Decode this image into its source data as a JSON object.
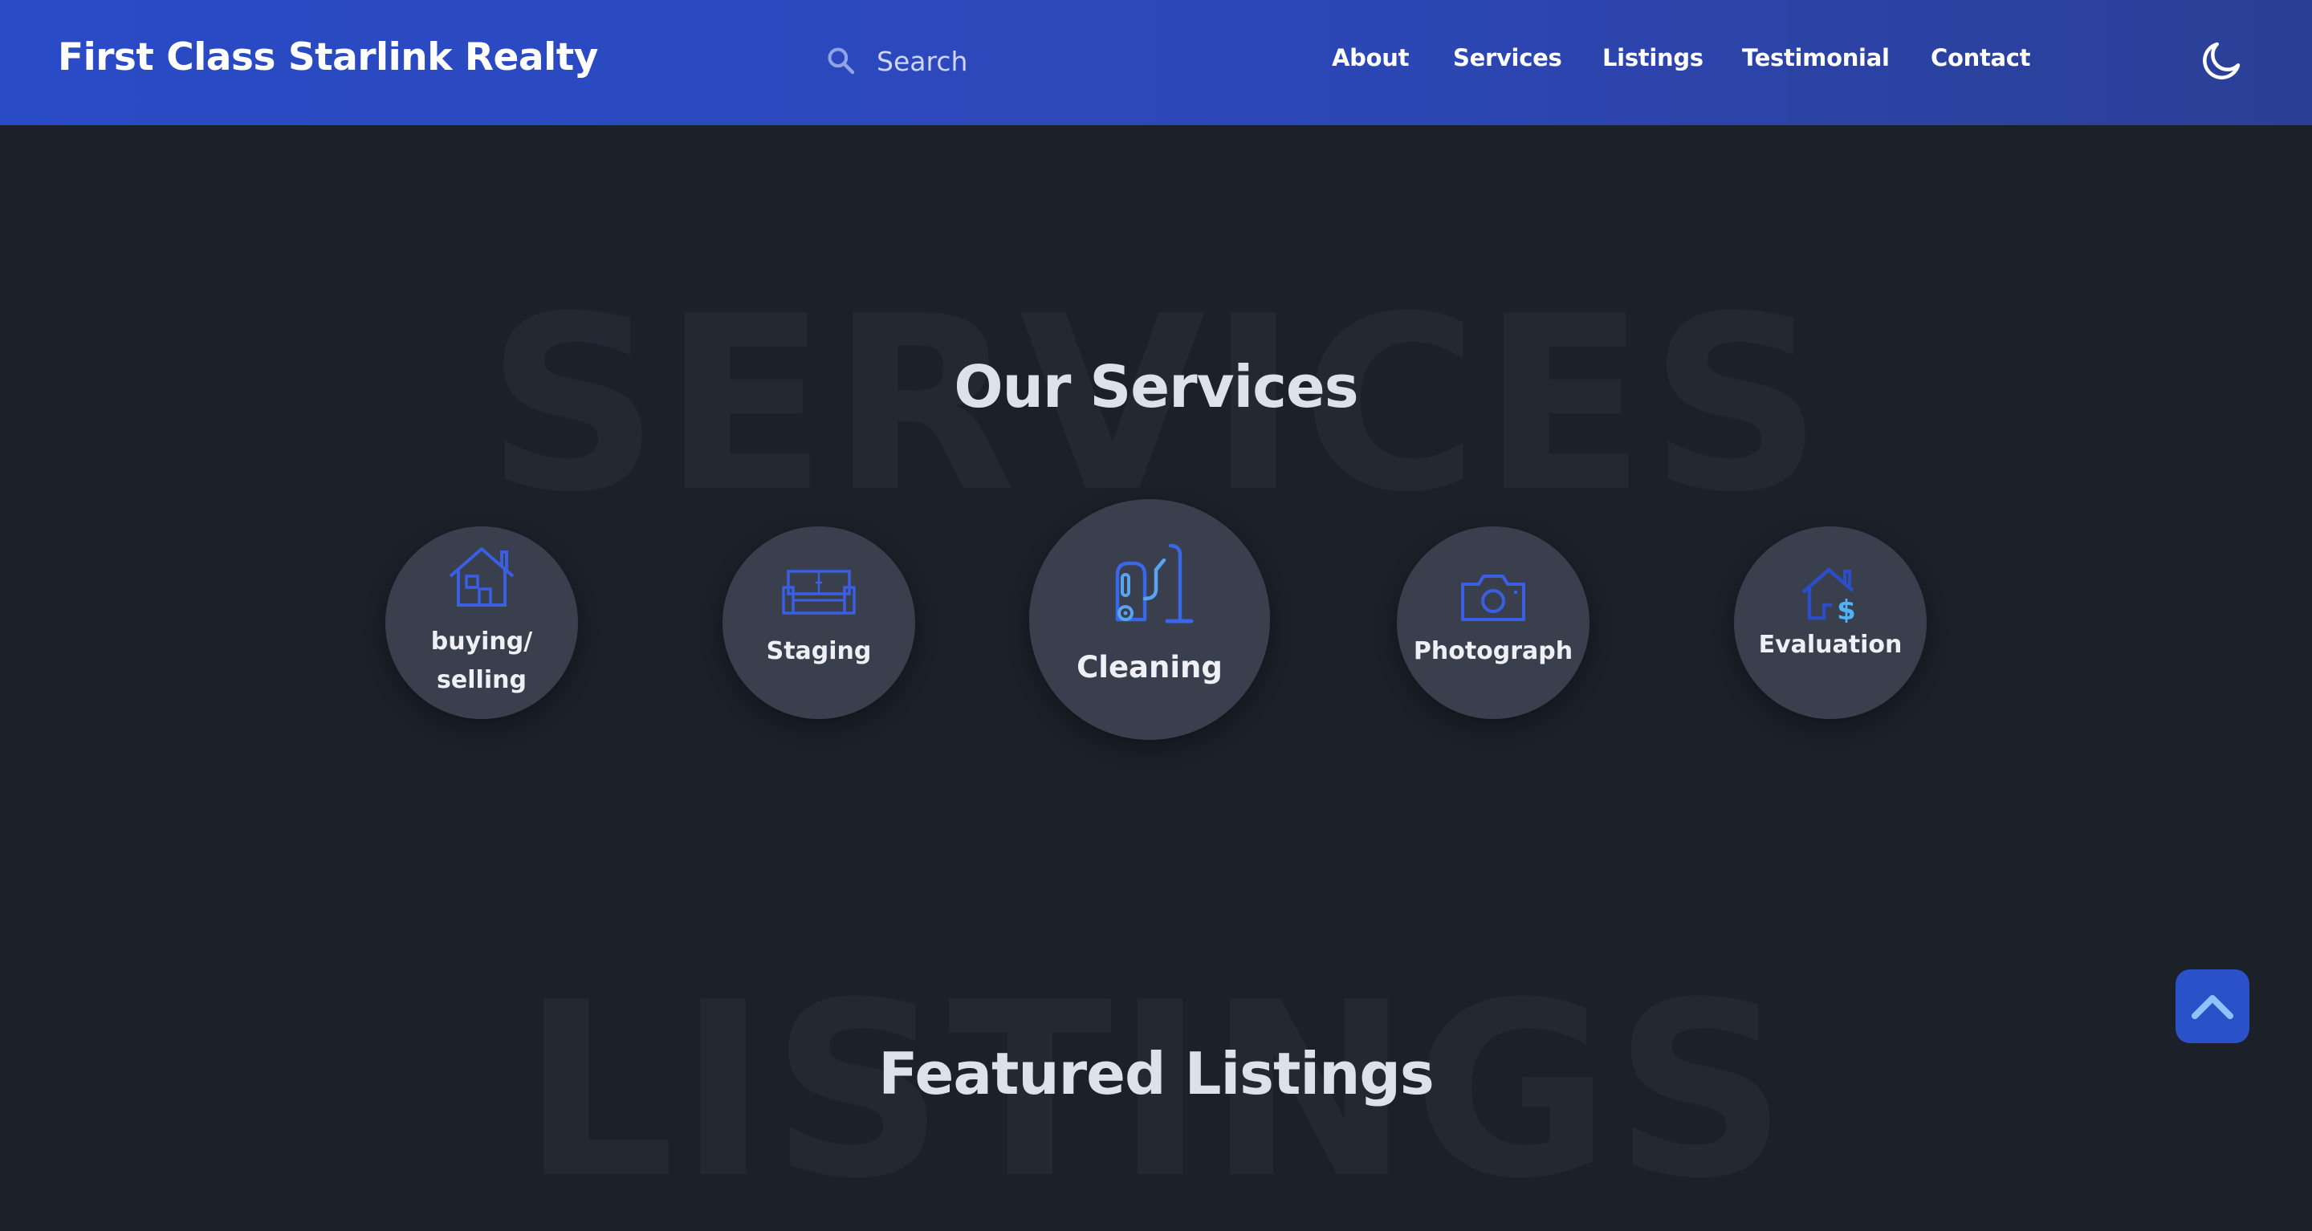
{
  "header": {
    "brand": "First Class Starlink Realty",
    "search_placeholder": "Search",
    "nav": [
      {
        "label": "About"
      },
      {
        "label": "Services"
      },
      {
        "label": "Listings"
      },
      {
        "label": "Testimonial"
      },
      {
        "label": "Contact"
      }
    ],
    "theme_toggle_icon": "moon-icon"
  },
  "services_section": {
    "watermark": "SERVICES",
    "title": "Our Services",
    "items": [
      {
        "label_line1": "buying/",
        "label_line2": "selling",
        "icon": "house-icon"
      },
      {
        "label": "Staging",
        "icon": "sofa-icon"
      },
      {
        "label": "Cleaning",
        "icon": "vacuum-icon"
      },
      {
        "label": "Photograph",
        "icon": "camera-icon"
      },
      {
        "label": "Evaluation",
        "icon": "house-dollar-icon"
      }
    ]
  },
  "listings_section": {
    "watermark": "LISTINGS",
    "title": "Featured Listings"
  },
  "scroll_top_icon": "chevron-up-icon",
  "colors": {
    "nav_gradient_start": "#2a4bc6",
    "nav_gradient_end": "#2b3f95",
    "page_background": "#1b2029",
    "service_circle": "#3a3f4e",
    "icon_blue": "#3a66e8",
    "scroll_button": "#2a51c7"
  }
}
